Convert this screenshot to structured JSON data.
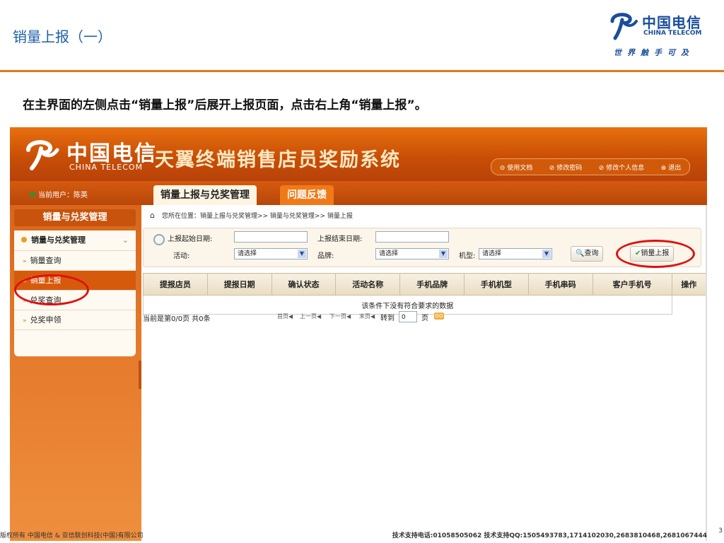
{
  "slide": {
    "title": "销量上报（一）",
    "instruction": "在主界面的左侧点击“销量上报”后展开上报页面，点击右上角“销量上报”。",
    "page_number": "3"
  },
  "brand": {
    "cn": "中国电信",
    "en": "CHINA TELECOM",
    "slogan": "世界触手可及"
  },
  "app": {
    "logo_cn": "中国电信",
    "logo_en": "CHINA TELECOM",
    "system_name": "天翼终端销售店员奖励系统",
    "top_links": [
      "⊝ 使用文档",
      "⊘ 修改密码",
      "⊘ 修改个人信息",
      "⊗ 退出"
    ],
    "user": "当前用户：陈英",
    "tabs": {
      "active": "销量上报与兑奖管理",
      "inactive": "问题反馈"
    },
    "sidebar": {
      "header": "销量与兑奖管理",
      "section": "销量与兑奖管理",
      "items": [
        "销量查询",
        "销量上报",
        "兑奖查询",
        "兑奖申领"
      ]
    },
    "breadcrumb": "您所在位置：销量上报与兑奖管理>> 销量与兑奖管理>> 销量上报",
    "filters": {
      "start_date_label": "上报起始日期:",
      "end_date_label": "上报结束日期:",
      "activity_label": "活动:",
      "activity_value": "请选择",
      "brand_label": "品牌:",
      "brand_value": "请选择",
      "model_label": "机型:",
      "model_value": "请选择",
      "query_button": "查询",
      "report_button": "销量上报"
    },
    "table": {
      "columns": [
        "提报店员",
        "提报日期",
        "确认状态",
        "活动名称",
        "手机品牌",
        "手机机型",
        "手机串码",
        "客户手机号",
        "操作"
      ],
      "empty_message": "该条件下没有符合要求的数据"
    },
    "pager": {
      "summary": "当前是第0/0页 共0条",
      "first": "首页◀",
      "prev": "上一页◀",
      "next": "下一页◀",
      "last": "末页◀",
      "goto_label": "转到",
      "goto_value": "0",
      "page_label": "页",
      "go": "GO"
    }
  },
  "footer": {
    "copyright": "版权所有 中国电信 & 亚信联创科技(中国)有限公司",
    "support": "技术支持电话:01058505062 技术支持QQ:1505493783,1714102030,2683810468,2681067444"
  },
  "colors": {
    "accent": "#e07a18",
    "brand_blue": "#1a4e9c",
    "highlight_ring": "#e01010"
  }
}
